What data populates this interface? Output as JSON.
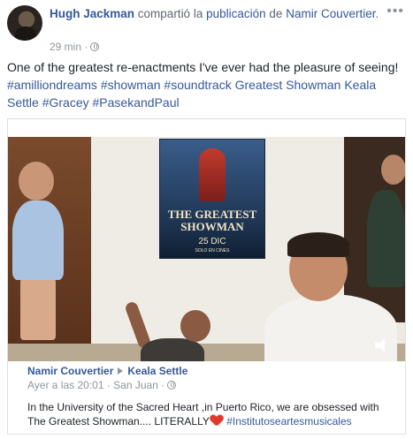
{
  "post": {
    "author": "Hugh Jackman",
    "action": "compartió la",
    "object": "publicación",
    "preposition": "de",
    "original_author": "Namir Couvertier",
    "trailing_period": ".",
    "time": "29 min ·",
    "more_icon": "more-dots-icon",
    "caption": {
      "text1": "One of the greatest re-enactments I've ever had the pleasure of seeing!",
      "tag1": "#amilliondreams",
      "tag2": "#showman",
      "tag3": "#soundtrack",
      "link1": "Greatest Showman",
      "link2": "Keala Settle",
      "tag4": "#Gracey",
      "tag5": "#PasekandPaul"
    }
  },
  "video": {
    "poster_title": "THE GREATEST SHOWMAN",
    "poster_date": "25 DIC",
    "poster_sub": "SOLO EN CINES",
    "volume_icon": "speaker-icon"
  },
  "shared": {
    "author": "Namir Couvertier",
    "target": "Keala Settle",
    "time": "Ayer a las 20:01 · San Juan ·",
    "text1": "In the University of the Sacred Heart ,in Puerto Rico, we are obsessed with The Greatest Showman.... LITERALLY",
    "tag": "#Institutoseartesmusicales"
  }
}
